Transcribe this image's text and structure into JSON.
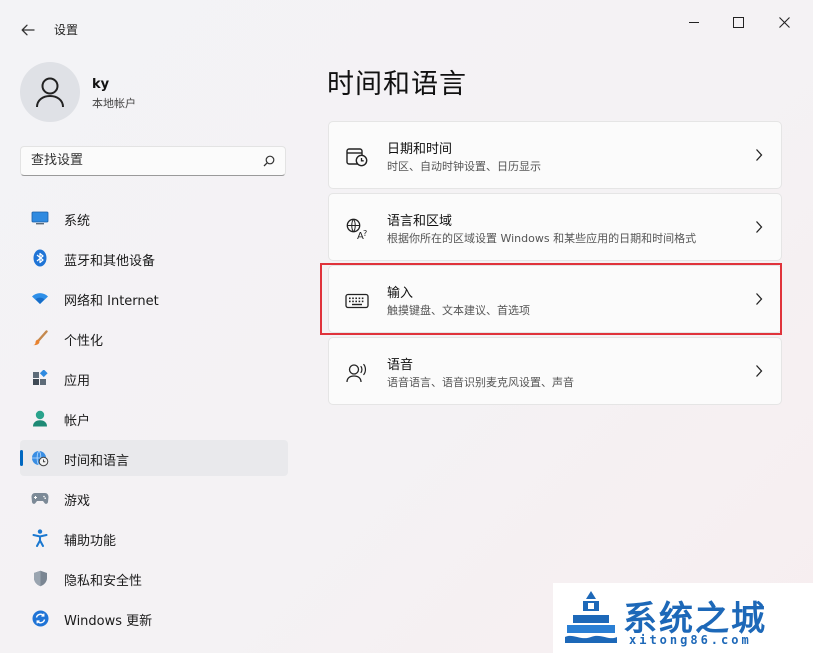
{
  "window": {
    "title": "设置"
  },
  "account": {
    "name": "ky",
    "type": "本地帐户"
  },
  "search": {
    "placeholder": "查找设置"
  },
  "nav": [
    {
      "label": "系统",
      "icon": "monitor-icon"
    },
    {
      "label": "蓝牙和其他设备",
      "icon": "bluetooth-icon"
    },
    {
      "label": "网络和 Internet",
      "icon": "wifi-icon"
    },
    {
      "label": "个性化",
      "icon": "brush-icon"
    },
    {
      "label": "应用",
      "icon": "apps-icon"
    },
    {
      "label": "帐户",
      "icon": "person-icon"
    },
    {
      "label": "时间和语言",
      "icon": "globe-clock-icon",
      "active": true
    },
    {
      "label": "游戏",
      "icon": "gamepad-icon"
    },
    {
      "label": "辅助功能",
      "icon": "accessibility-icon"
    },
    {
      "label": "隐私和安全性",
      "icon": "shield-icon"
    },
    {
      "label": "Windows 更新",
      "icon": "update-icon"
    }
  ],
  "page": {
    "title": "时间和语言"
  },
  "cards": [
    {
      "title": "日期和时间",
      "subtitle": "时区、自动时钟设置、日历显示",
      "icon": "calendar-clock-icon"
    },
    {
      "title": "语言和区域",
      "subtitle": "根据你所在的区域设置 Windows 和某些应用的日期和时间格式",
      "icon": "language-icon"
    },
    {
      "title": "输入",
      "subtitle": "触摸键盘、文本建议、首选项",
      "icon": "keyboard-icon",
      "highlighted": true
    },
    {
      "title": "语音",
      "subtitle": "语音语言、语音识别麦克风设置、声音",
      "icon": "speech-icon"
    }
  ],
  "watermark": {
    "title": "系统之城",
    "domain": "xitong86.com"
  },
  "colors": {
    "accent": "#0067c0",
    "highlight_border": "#e0333b",
    "watermark": "#1d68b8"
  }
}
